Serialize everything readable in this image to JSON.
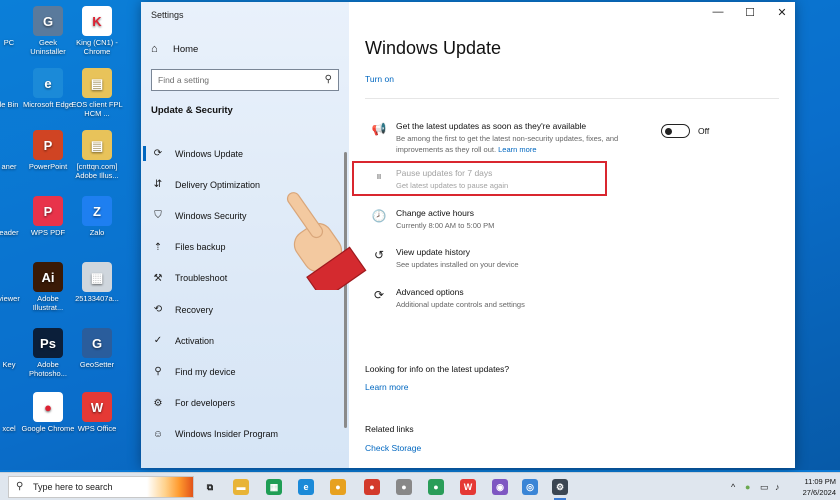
{
  "desktop": {
    "icons": [
      {
        "label": "PC",
        "color": "#3a85d6",
        "glyph": "▣"
      },
      {
        "label": "Geek Uninstaller",
        "color": "#5a7a9c",
        "glyph": "G"
      },
      {
        "label": "King (CN1) - Chrome",
        "color": "#ffffff",
        "glyph": "K"
      },
      {
        "label": "le Bin",
        "color": "#7fb0e6",
        "glyph": "♻"
      },
      {
        "label": "Microsoft Edge",
        "color": "#1b8ad8",
        "glyph": "e"
      },
      {
        "label": "EOS client FPL HCM ...",
        "color": "#e8c35a",
        "glyph": "▤"
      },
      {
        "label": "aner",
        "color": "#e04a2a",
        "glyph": "S"
      },
      {
        "label": "PowerPoint",
        "color": "#d04423",
        "glyph": "P"
      },
      {
        "label": "[cnttqn.com] Adobe Illus...",
        "color": "#e8c35a",
        "glyph": "▤"
      },
      {
        "label": "eader",
        "color": "#f07d22",
        "glyph": "F"
      },
      {
        "label": "WPS PDF",
        "color": "#e8334a",
        "glyph": "P"
      },
      {
        "label": "Zalo",
        "color": "#1e7ff0",
        "glyph": "Z"
      },
      {
        "label": "viewer",
        "color": "#3a85d6",
        "glyph": "◎"
      },
      {
        "label": "Adobe Illustrat...",
        "color": "#3a1a06",
        "glyph": "Ai"
      },
      {
        "label": "25133407a...",
        "color": "#cfd6dd",
        "glyph": "▦"
      },
      {
        "label": "Key",
        "color": "#e8a020",
        "glyph": "K"
      },
      {
        "label": "Adobe Photosho...",
        "color": "#0b1f3a",
        "glyph": "Ps"
      },
      {
        "label": "GeoSetter",
        "color": "#2a5d9c",
        "glyph": "G"
      },
      {
        "label": "xcel",
        "color": "#1d7a45",
        "glyph": "X"
      },
      {
        "label": "Google Chrome",
        "color": "#ffffff",
        "glyph": "●"
      },
      {
        "label": "WPS Office",
        "color": "#e53935",
        "glyph": "W"
      }
    ]
  },
  "window": {
    "title": "Settings",
    "controls": {
      "minimize": "—",
      "maximize": "☐",
      "close": "✕"
    }
  },
  "sidebar": {
    "home_label": "Home",
    "search_placeholder": "Find a setting",
    "section_title": "Update & Security",
    "items": [
      {
        "label": "Windows Update",
        "icon": "sync-icon",
        "glyph": "⟳",
        "active": true
      },
      {
        "label": "Delivery Optimization",
        "icon": "delivery-icon",
        "glyph": "⇵",
        "active": false
      },
      {
        "label": "Windows Security",
        "icon": "shield-icon",
        "glyph": "⛉",
        "active": false
      },
      {
        "label": "Files backup",
        "icon": "backup-icon",
        "glyph": "⇡",
        "active": false
      },
      {
        "label": "Troubleshoot",
        "icon": "wrench-icon",
        "glyph": "⚒",
        "active": false
      },
      {
        "label": "Recovery",
        "icon": "recovery-icon",
        "glyph": "⟲",
        "active": false
      },
      {
        "label": "Activation",
        "icon": "activation-icon",
        "glyph": "✓",
        "active": false
      },
      {
        "label": "Find my device",
        "icon": "person-icon",
        "glyph": "⚲",
        "active": false
      },
      {
        "label": "For developers",
        "icon": "developer-icon",
        "glyph": "⚙",
        "active": false
      },
      {
        "label": "Windows Insider Program",
        "icon": "insider-icon",
        "glyph": "☺",
        "active": false
      }
    ]
  },
  "main": {
    "title": "Windows Update",
    "turn_on": "Turn on",
    "latest_updates": {
      "title": "Get the latest updates as soon as they're available",
      "desc_line1": "Be among the first to get the latest non-security updates, fixes, and",
      "desc_line2": "improvements as they roll out.",
      "learn_more": "Learn more",
      "toggle_state": "Off"
    },
    "pause": {
      "title": "Pause updates for 7 days",
      "desc": "Get latest updates to pause again"
    },
    "active_hours": {
      "title": "Change active hours",
      "desc": "Currently 8:00 AM to 5:00 PM"
    },
    "history": {
      "title": "View update history",
      "desc": "See updates installed on your device"
    },
    "advanced": {
      "title": "Advanced options",
      "desc": "Additional update controls and settings"
    },
    "looking": {
      "title": "Looking for info on the latest updates?",
      "link": "Learn more"
    },
    "related": {
      "title": "Related links",
      "link": "Check Storage"
    }
  },
  "taskbar": {
    "search_placeholder": "Type here to search",
    "time": "11:09 PM",
    "date": "27/6/2024",
    "tray_caret": "^"
  }
}
